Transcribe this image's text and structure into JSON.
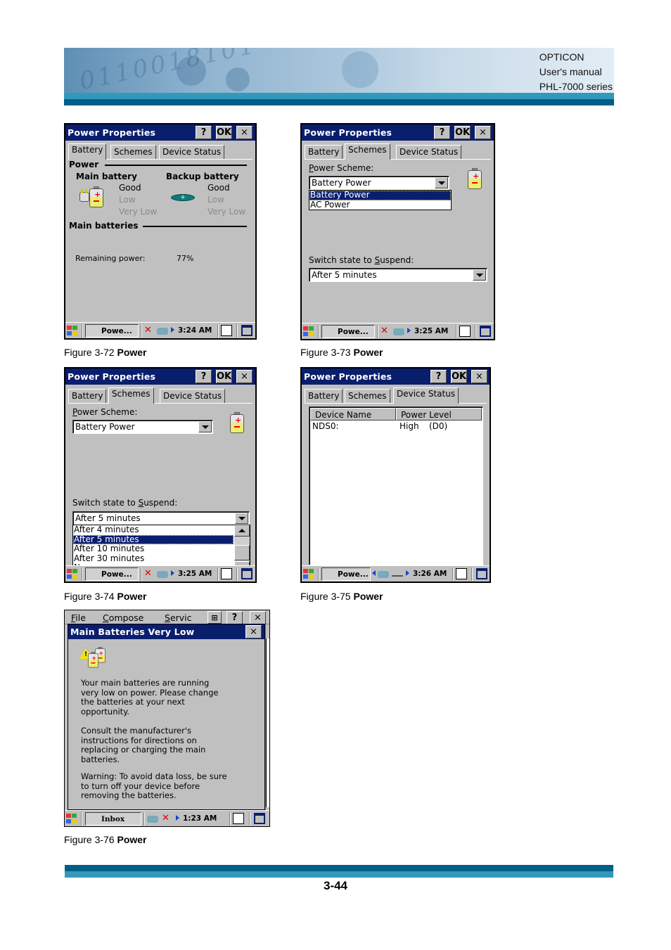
{
  "header": {
    "brand_lines": [
      "OPTICON",
      "User's manual",
      "PHL-7000 series"
    ]
  },
  "footer": {
    "page_number": "3-44"
  },
  "colors": {
    "titlebar": "#0a1e6e",
    "window_bg": "#c0c0c0",
    "stripe_dark": "#005f87",
    "stripe_light": "#3399bb"
  },
  "figures": [
    {
      "caption_prefix": "Figure 3-72 ",
      "caption_bold": "Power",
      "window": {
        "title": "Power Properties",
        "buttons": {
          "help": "?",
          "ok": "OK",
          "close": "×"
        },
        "tabs": [
          "Battery",
          "Schemes",
          "Device Status"
        ],
        "active_tab": "Battery",
        "power_group": "Power",
        "main_battery_label": "Main battery",
        "backup_battery_label": "Backup battery",
        "main_levels": [
          "Good",
          "Low",
          "Very Low"
        ],
        "backup_levels": [
          "Good",
          "Low",
          "Very Low"
        ],
        "main_batteries_group": "Main batteries",
        "remaining_power_label": "Remaining power:",
        "remaining_power_value": "77%"
      },
      "taskbar": {
        "task": "Powe...",
        "clock": "3:24 AM"
      }
    },
    {
      "caption_prefix": "Figure 3-73 ",
      "caption_bold": "Power",
      "window": {
        "title": "Power Properties",
        "buttons": {
          "help": "?",
          "ok": "OK",
          "close": "×"
        },
        "tabs": [
          "Battery",
          "Schemes",
          "Device Status"
        ],
        "active_tab": "Schemes",
        "power_scheme_label_ul": "P",
        "power_scheme_label_rest": "ower Scheme:",
        "power_scheme_value": "Battery Power",
        "power_scheme_options": [
          "Battery Power",
          "AC Power"
        ],
        "power_scheme_selected": "Battery Power",
        "suspend_label_pre": "Switch state to ",
        "suspend_label_ul": "S",
        "suspend_label_rest": "uspend:",
        "suspend_value": "After 5 minutes"
      },
      "taskbar": {
        "task": "Powe...",
        "clock": "3:25 AM"
      }
    },
    {
      "caption_prefix": "Figure 3-74 ",
      "caption_bold": "Power",
      "window": {
        "title": "Power Properties",
        "buttons": {
          "help": "?",
          "ok": "OK",
          "close": "×"
        },
        "tabs": [
          "Battery",
          "Schemes",
          "Device Status"
        ],
        "active_tab": "Schemes",
        "power_scheme_label_ul": "P",
        "power_scheme_label_rest": "ower Scheme:",
        "power_scheme_value": "Battery Power",
        "suspend_label_pre": "Switch state to ",
        "suspend_label_ul": "S",
        "suspend_label_rest": "uspend:",
        "suspend_value": "After 5 minutes",
        "suspend_options": [
          "After 4 minutes",
          "After 5 minutes",
          "After 10 minutes",
          "After 30 minutes",
          "Never"
        ],
        "suspend_selected": "After 5 minutes"
      },
      "taskbar": {
        "task": "Powe...",
        "clock": "3:25 AM"
      }
    },
    {
      "caption_prefix": "Figure 3-75 ",
      "caption_bold": "Power",
      "window": {
        "title": "Power Properties",
        "buttons": {
          "help": "?",
          "ok": "OK",
          "close": "×"
        },
        "tabs": [
          "Battery",
          "Schemes",
          "Device Status"
        ],
        "active_tab": "Device Status",
        "columns": [
          "Device Name",
          "Power Level"
        ],
        "rows": [
          {
            "device": "NDS0:",
            "level": "High",
            "state": "(D0)"
          }
        ]
      },
      "taskbar": {
        "task": "Powe...",
        "clock": "3:26 AM"
      }
    },
    {
      "caption_prefix": "Figure 3-76 ",
      "caption_bold": "Power",
      "background_menu": [
        "File",
        "Compose",
        "Servic"
      ],
      "background_buttons": {
        "help": "?",
        "close": "×"
      },
      "dialog": {
        "title": "Main Batteries Very Low",
        "close": "×",
        "paragraphs": [
          [
            "Your main batteries are running",
            "very low on power. Please change",
            "the batteries at your next",
            "opportunity."
          ],
          [
            "Consult the manufacturer's",
            "instructions for directions on",
            "replacing or charging the main",
            "batteries."
          ],
          [
            "Warning: To avoid data loss, be sure",
            "to turn off your device before",
            "removing the batteries."
          ]
        ]
      },
      "taskbar": {
        "task": "Inbox",
        "clock": "1:23 AM"
      }
    }
  ]
}
